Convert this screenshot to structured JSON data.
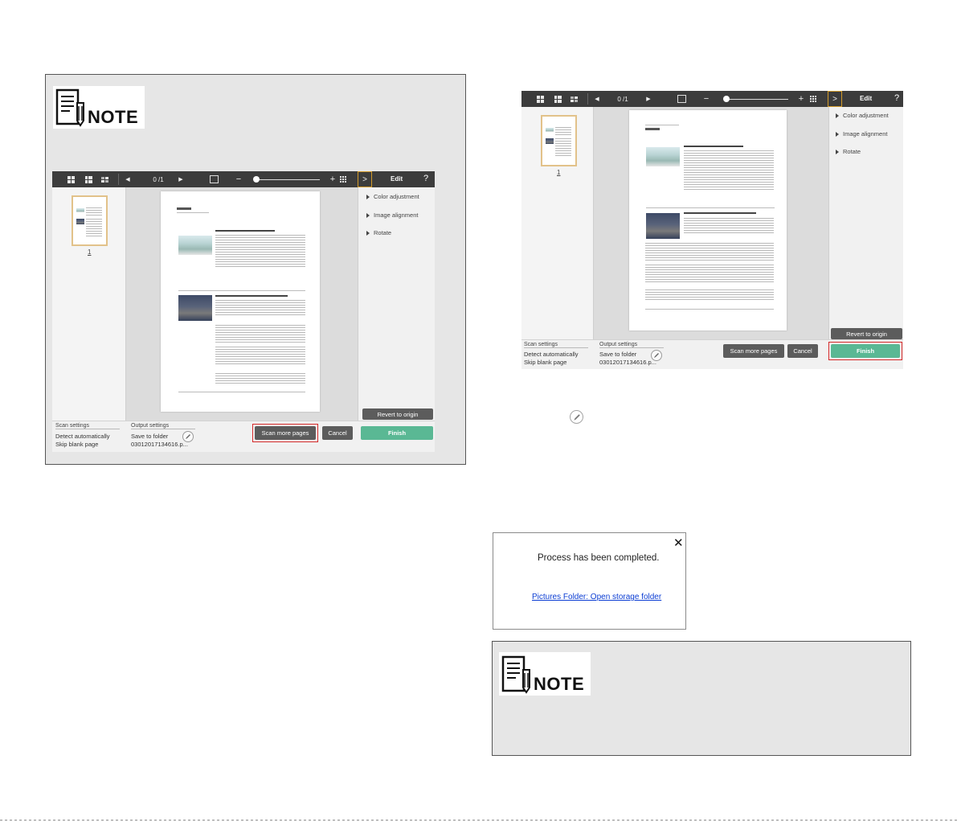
{
  "notes": [
    {
      "label": "NOTE"
    },
    {
      "label": "NOTE"
    }
  ],
  "app_left": {
    "toolbar": {
      "page_counter": "0 /1",
      "zoom_minus": "−",
      "zoom_plus": "+",
      "expand": ">",
      "edit": "Edit",
      "help": "?"
    },
    "thumbnail_page_number": "1",
    "right_panel": {
      "items": [
        "Color adjustment",
        "Image alignment",
        "Rotate"
      ],
      "revert": "Revert to origin"
    },
    "scan_settings": {
      "title": "Scan settings",
      "lines": [
        "Detect automatically",
        "Skip blank page"
      ]
    },
    "output_settings": {
      "title": "Output settings",
      "lines": [
        "Save to folder",
        "03012017134616.p..."
      ]
    },
    "buttons": {
      "scan_more": "Scan more pages",
      "cancel": "Cancel",
      "finish": "Finish"
    },
    "highlighted": "scan_more"
  },
  "app_right": {
    "toolbar": {
      "page_counter": "0 /1",
      "zoom_minus": "−",
      "zoom_plus": "+",
      "expand": ">",
      "edit": "Edit",
      "help": "?"
    },
    "thumbnail_page_number": "1",
    "right_panel": {
      "items": [
        "Color adjustment",
        "Image alignment",
        "Rotate"
      ],
      "revert": "Revert to origin"
    },
    "scan_settings": {
      "title": "Scan settings",
      "lines": [
        "Detect automatically",
        "Skip blank page"
      ]
    },
    "output_settings": {
      "title": "Output settings",
      "lines": [
        "Save to folder",
        "03012017134616.p..."
      ]
    },
    "buttons": {
      "scan_more": "Scan more pages",
      "cancel": "Cancel",
      "finish": "Finish"
    },
    "highlighted": "finish"
  },
  "dialog": {
    "message": "Process has been completed.",
    "link": "Pictures Folder: Open storage folder",
    "close": "✕"
  },
  "colors": {
    "toolbar": "#3c3c3c",
    "finish_green": "#5ab894",
    "highlight_red": "#d42828",
    "edit_tab_border": "#d29a2a",
    "link_blue": "#0a3cd3"
  },
  "icons": [
    "note-icon",
    "grid-large-icon",
    "grid-medium-icon",
    "grid-small-icon",
    "prev-page-icon",
    "next-page-icon",
    "fit-page-icon",
    "zoom-slider",
    "thumbnail-grid-icon",
    "pencil-icon",
    "close-icon"
  ]
}
